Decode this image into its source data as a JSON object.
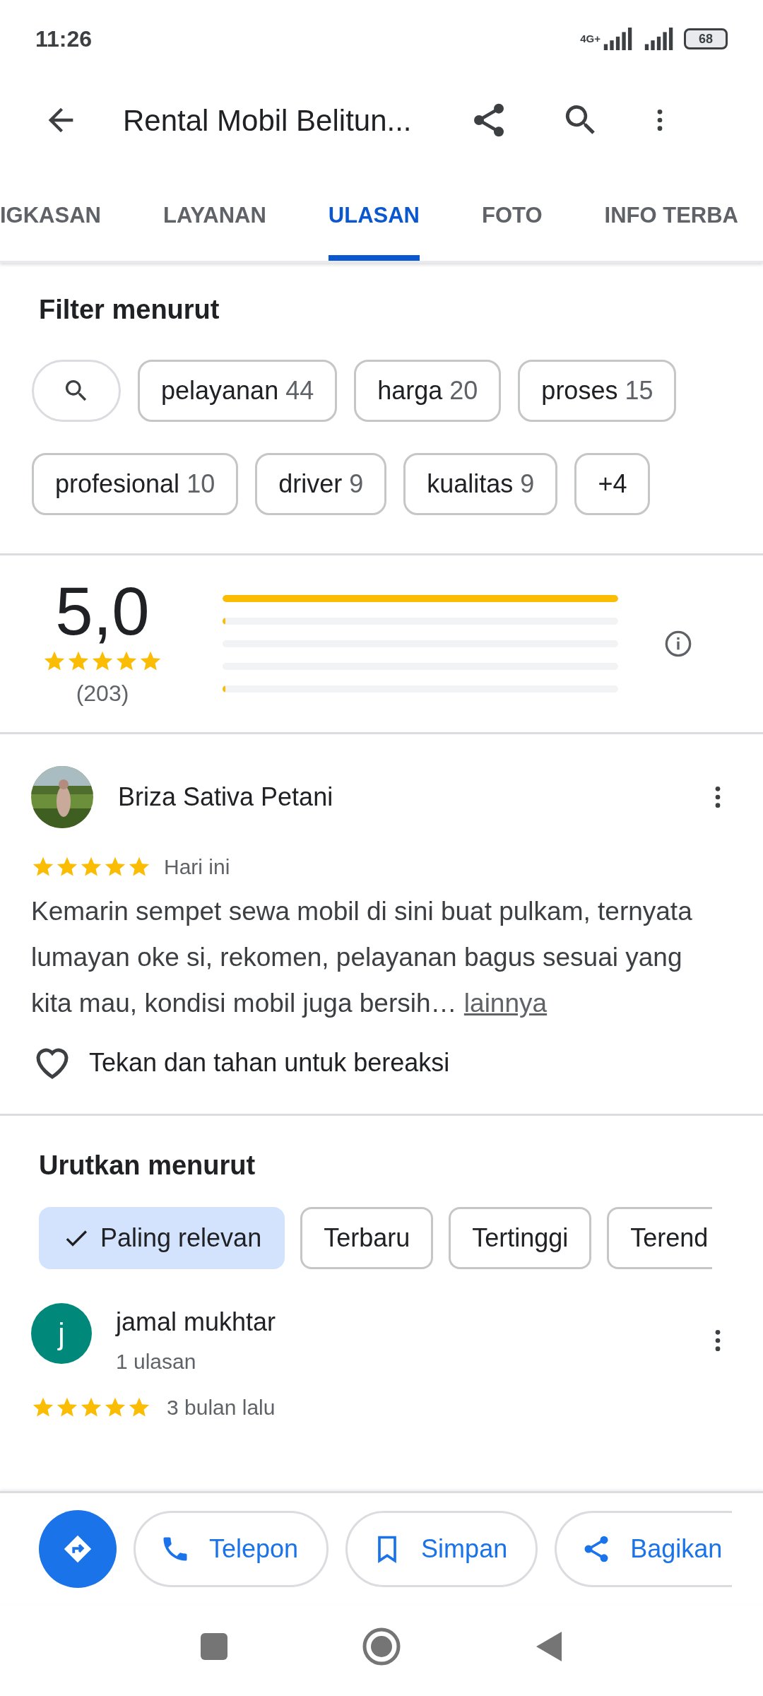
{
  "status_bar": {
    "time": "11:26",
    "network": "4G+",
    "battery": "68"
  },
  "app_bar": {
    "title": "Rental Mobil Belitun..."
  },
  "tabs": [
    {
      "label": "IGKASAN",
      "selected": false
    },
    {
      "label": "LAYANAN",
      "selected": false
    },
    {
      "label": "ULASAN",
      "selected": true
    },
    {
      "label": "FOTO",
      "selected": false
    },
    {
      "label": "INFO TERBA",
      "selected": false
    }
  ],
  "filter": {
    "title": "Filter menurut",
    "chips": [
      {
        "label": "pelayanan",
        "count": "44"
      },
      {
        "label": "harga",
        "count": "20"
      },
      {
        "label": "proses",
        "count": "15"
      },
      {
        "label": "profesional",
        "count": "10"
      },
      {
        "label": "driver",
        "count": "9"
      },
      {
        "label": "kualitas",
        "count": "9"
      },
      {
        "label": "+4"
      }
    ]
  },
  "rating": {
    "score": "5,0",
    "stars": 5,
    "count": "(203)",
    "bars": [
      {
        "level": 1
      },
      {
        "level": 0.005
      },
      {
        "level": 0
      },
      {
        "level": 0
      },
      {
        "level": 0.005
      }
    ]
  },
  "featured_review": {
    "author": "Briza Sativa Petani",
    "stars": 5,
    "time": "Hari ini",
    "text": "Kemarin sempet sewa mobil di sini buat pulkam, ternyata lumayan oke si, rekomen, pelayanan bagus sesuai yang kita mau, kondisi mobil juga bersih…",
    "more": "lainnya",
    "reaction": "Tekan dan tahan untuk bereaksi"
  },
  "sort": {
    "title": "Urutkan menurut",
    "options": [
      {
        "label": "Paling relevan",
        "selected": true
      },
      {
        "label": "Terbaru",
        "selected": false
      },
      {
        "label": "Tertinggi",
        "selected": false
      },
      {
        "label": "Terend",
        "selected": false
      }
    ]
  },
  "reviews": [
    {
      "initial": "j",
      "color": "#00897b",
      "author": "jamal mukhtar",
      "meta": "1 ulasan",
      "stars": 5,
      "time": "3 bulan lalu"
    }
  ],
  "actions": [
    {
      "label": "Telepon",
      "kind": "phone"
    },
    {
      "label": "Simpan",
      "kind": "save"
    },
    {
      "label": "Bagikan",
      "kind": "share"
    }
  ]
}
